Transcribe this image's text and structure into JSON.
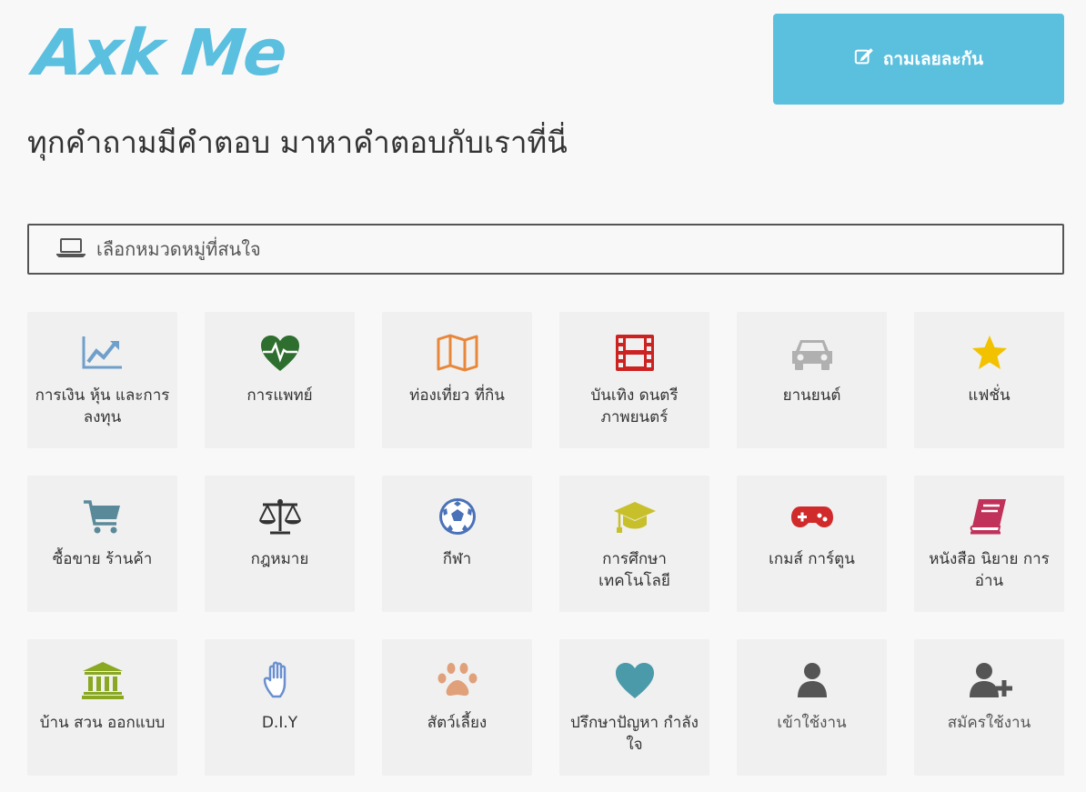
{
  "header": {
    "logo_text": "Axk Me",
    "ask_button_label": "ถามเลยละกัน",
    "tagline": "ทุกคำถามมีคำตอบ มาหาคำตอบกับเราที่นี่"
  },
  "category_select": {
    "placeholder": "เลือกหมวดหมู่ที่สนใจ"
  },
  "colors": {
    "brand": "#5bc0de",
    "tile_bg": "#f0f0f0"
  },
  "categories": [
    {
      "label": "การเงิน หุ้น และการลงทุน",
      "icon": "chart-line-icon",
      "color": "#6f9fca"
    },
    {
      "label": "การแพทย์",
      "icon": "heartbeat-icon",
      "color": "#2e6e2e"
    },
    {
      "label": "ท่องเที่ยว ที่กิน",
      "icon": "map-icon",
      "color": "#e8873a"
    },
    {
      "label": "บันเทิง ดนตรี ภาพยนตร์",
      "icon": "film-icon",
      "color": "#cc2222"
    },
    {
      "label": "ยานยนต์",
      "icon": "car-icon",
      "color": "#b0b0b0"
    },
    {
      "label": "แฟชั่น",
      "icon": "star-icon",
      "color": "#f2c200"
    },
    {
      "label": "ซื้อขาย ร้านค้า",
      "icon": "shopping-cart-icon",
      "color": "#5a8a9a"
    },
    {
      "label": "กฎหมาย",
      "icon": "balance-scale-icon",
      "color": "#333333"
    },
    {
      "label": "กีฬา",
      "icon": "soccer-ball-icon",
      "color": "#4a72b8"
    },
    {
      "label": "การศึกษา เทคโนโลยี",
      "icon": "graduation-cap-icon",
      "color": "#c8c02a"
    },
    {
      "label": "เกมส์ การ์ตูน",
      "icon": "gamepad-icon",
      "color": "#d02a2a"
    },
    {
      "label": "หนังสือ นิยาย การอ่าน",
      "icon": "book-icon",
      "color": "#c0325a"
    },
    {
      "label": "บ้าน สวน ออกแบบ",
      "icon": "bank-icon",
      "color": "#8aa822"
    },
    {
      "label": "D.I.Y",
      "icon": "hand-icon",
      "color": "#6a8fd0"
    },
    {
      "label": "สัตว์เลี้ยง",
      "icon": "paw-icon",
      "color": "#e0a07a"
    },
    {
      "label": "ปรึกษาปัญหา กำลังใจ",
      "icon": "heart-icon",
      "color": "#4a9aaa"
    },
    {
      "label": "เข้าใช้งาน",
      "icon": "user-icon",
      "color": "#555555"
    },
    {
      "label": "สมัครใช้งาน",
      "icon": "user-plus-icon",
      "color": "#555555"
    }
  ]
}
